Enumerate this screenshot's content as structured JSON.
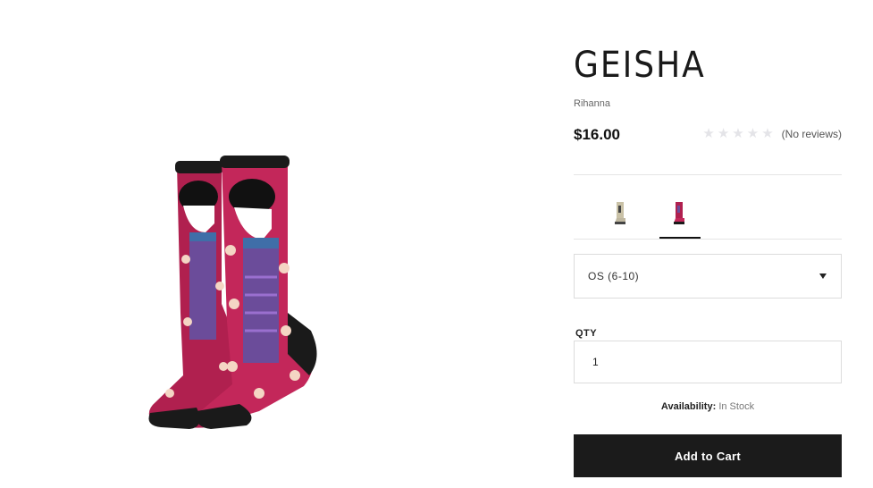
{
  "product": {
    "title": "GEISHA",
    "brand": "Rihanna",
    "price": "$16.00",
    "rating": {
      "stars": 0,
      "max_stars": 5,
      "reviews_text": "(No reviews)"
    },
    "main_image_icon": "geisha-socks-image"
  },
  "swatches": [
    {
      "icon": "sock-thumbnail-light",
      "selected": false
    },
    {
      "icon": "sock-thumbnail-pink",
      "selected": true
    }
  ],
  "size_select": {
    "value": "OS (6-10)"
  },
  "quantity": {
    "label": "QTY",
    "value": "1"
  },
  "availability": {
    "label": "Availability:",
    "value": "In Stock"
  },
  "cart_button": {
    "label": "Add to Cart"
  },
  "colors": {
    "sock_magenta": "#b0204f",
    "button_bg": "#1b1b1b",
    "star_empty": "#e4e4e8"
  }
}
